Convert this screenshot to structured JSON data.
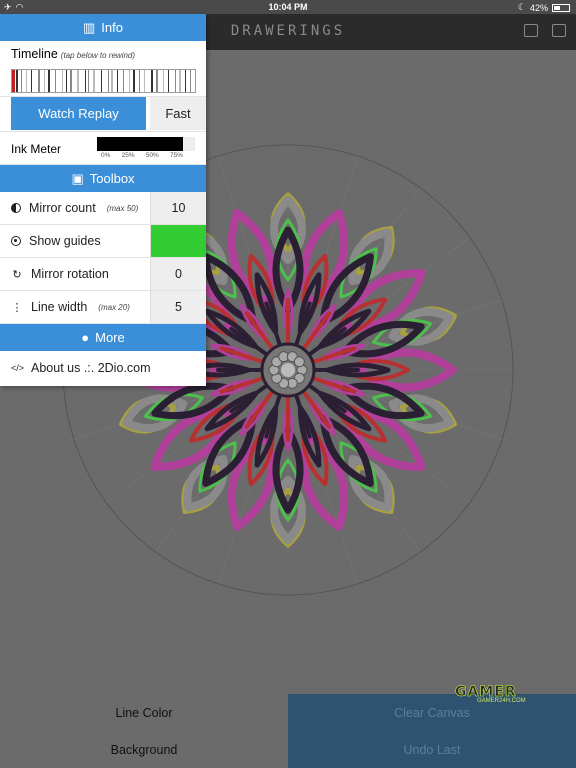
{
  "status_bar": {
    "time": "10:04 PM",
    "battery": "42%",
    "battery_level": 0.42
  },
  "app": {
    "title": "DRAWERINGS",
    "icons": [
      "save-icon",
      "image-icon"
    ]
  },
  "panel": {
    "info_header": "Info",
    "timeline_label": "Timeline",
    "timeline_hint": "(tap below to rewind)",
    "watch_replay": "Watch Replay",
    "speed": "Fast",
    "ink_meter_label": "Ink Meter",
    "ink_level": 0.88,
    "ink_ticks": [
      "0%",
      "25%",
      "50%",
      "75%"
    ],
    "toolbox_header": "Toolbox",
    "mirror_count_label": "Mirror count",
    "mirror_count_hint": "(max 50)",
    "mirror_count_value": "10",
    "show_guides_label": "Show guides",
    "show_guides_on": true,
    "guides_color": "#33cc33",
    "mirror_rotation_label": "Mirror rotation",
    "mirror_rotation_value": "0",
    "line_width_label": "Line width",
    "line_width_hint": "(max 20)",
    "line_width_value": "5",
    "more_header": "More",
    "about_label": "About us .:. 2Dio.com"
  },
  "bottom": {
    "line_color": "Line Color",
    "background": "Background",
    "clear_canvas": "Clear Canvas",
    "undo_last": "Undo Last"
  },
  "watermark": {
    "main": "GAMER",
    "sub": "GAMER24H.COM"
  },
  "colors": {
    "accent": "#3a8fd8",
    "canvas_bg": "#6b6b6b",
    "mandala_pink": "#b0409a",
    "mandala_red": "#b83030",
    "mandala_dark": "#2a1f33",
    "mandala_green": "#4cbf4c",
    "mandala_yellow": "#a7a040",
    "mandala_gray": "#8a8a8a"
  }
}
